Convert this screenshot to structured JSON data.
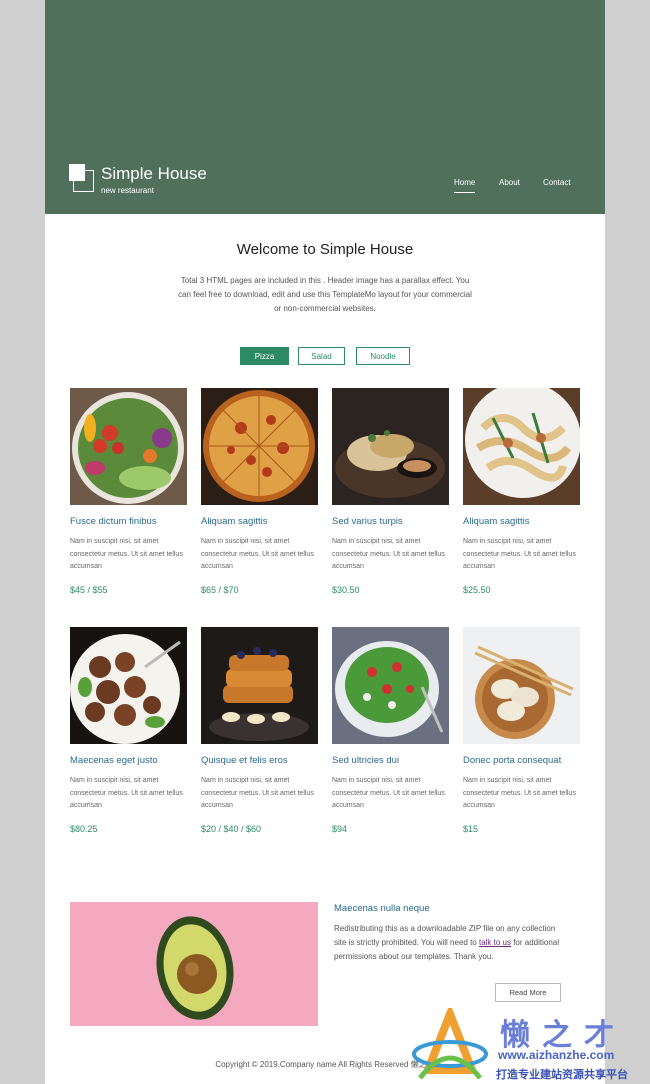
{
  "header": {
    "brand_title": "Simple House",
    "brand_subtitle": "new restaurant",
    "nav": [
      "Home",
      "About",
      "Contact"
    ],
    "active_nav": "Home",
    "background_color": "#50705c"
  },
  "welcome": {
    "title": "Welcome to Simple House",
    "text": "Total 3 HTML pages are included in this . Header image has a parallax effect. You can feel free to download, edit and use this TemplateMo layout for your commercial or non-commercial websites."
  },
  "tabs": [
    {
      "label": "Pizza",
      "active": true
    },
    {
      "label": "Salad",
      "active": false
    },
    {
      "label": "Noodle",
      "active": false
    }
  ],
  "menu_items": [
    {
      "title": "Fusce dictum finibus",
      "desc": "Nam in suscipit nisi, sit amet consectetur metus. Ut sit amet tellus accumsan",
      "price": "$45 / $55",
      "image": "salad-bowl"
    },
    {
      "title": "Aliquam sagittis",
      "desc": "Nam in suscipit nisi, sit amet consectetur metus. Ut sit amet tellus accumsan",
      "price": "$65 / $70",
      "image": "pizza"
    },
    {
      "title": "Sed varius turpis",
      "desc": "Nam in suscipit nisi, sit amet consectetur metus. Ut sit amet tellus accumsan",
      "price": "$30.50",
      "image": "grilled-chicken"
    },
    {
      "title": "Aliquam sagittis",
      "desc": "Nam in suscipit nisi, sit amet consectetur metus. Ut sit amet tellus accumsan",
      "price": "$25.50",
      "image": "pasta"
    },
    {
      "title": "Maecenas eget justo",
      "desc": "Nam in suscipit nisi, sit amet consectetur metus. Ut sit amet tellus accumsan",
      "price": "$80.25",
      "image": "meatballs"
    },
    {
      "title": "Quisque et felis eros",
      "desc": "Nam in suscipit nisi, sit amet consectetur metus. Ut sit amet tellus accumsan",
      "price": "$20 / $40 / $60",
      "image": "french-toast"
    },
    {
      "title": "Sed ultricies dui",
      "desc": "Nam in suscipit nisi, sit amet consectetur metus. Ut sit amet tellus accumsan",
      "price": "$94",
      "image": "green-salad"
    },
    {
      "title": "Donec porta consequat",
      "desc": "Nam in suscipit nisi, sit amet consectetur metus. Ut sit amet tellus accumsan",
      "price": "$15",
      "image": "dumplings"
    }
  ],
  "feature": {
    "title": "Maecenas nulla neque",
    "text_before": "Redistributing this as a downloadable ZIP file on any collection site is strictly prohibited. You will need to ",
    "link_text": "talk to us",
    "text_after": " for additional permissions about our templates. Thank you.",
    "button": "Read More",
    "image": "avocado"
  },
  "footer": {
    "copyright": "Copyright © 2019.Company name All Rights Reserved 懒之才"
  },
  "watermark": {
    "brand": "懒之才",
    "url": "www.aizhanzhe.com",
    "slogan": "打造专业建站资源共享平台"
  },
  "colors": {
    "accent_green": "#2d8c63",
    "link_blue": "#2a6a8f",
    "avocado_bg": "#f4a9c0"
  }
}
